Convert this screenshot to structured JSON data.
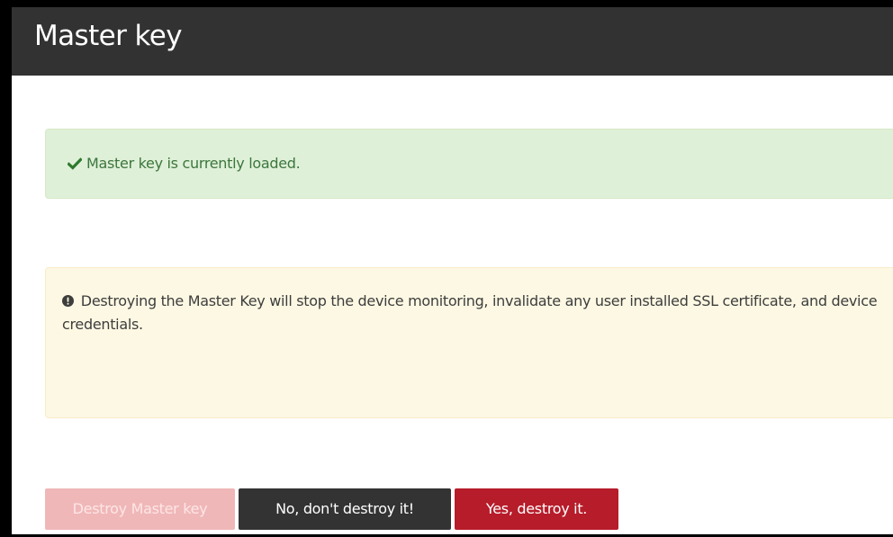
{
  "header": {
    "title": "Master key"
  },
  "alerts": {
    "success": {
      "icon": "checkmark-icon",
      "text": "Master key is currently loaded."
    },
    "warning": {
      "icon": "exclamation-circle-icon",
      "text": "Destroying the Master Key will stop the device monitoring, invalidate any user installed SSL certificate, and device credentials."
    }
  },
  "buttons": {
    "destroy_label": "Destroy Master key",
    "no_label": "No, don't destroy it!",
    "yes_label": "Yes, destroy it."
  },
  "colors": {
    "header_bg": "#323232",
    "success_bg": "#dff0d8",
    "warning_bg": "#fcf8e3",
    "destroy_disabled": "#f0b7b8",
    "no_button": "#333333",
    "yes_button": "#b71c2a"
  }
}
